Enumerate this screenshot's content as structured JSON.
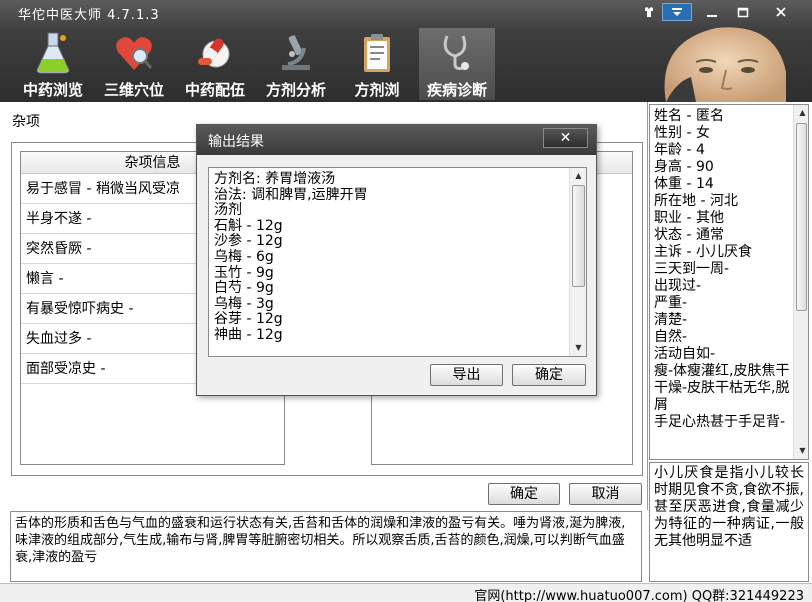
{
  "window": {
    "title": "华佗中医大师 4.7.1.3"
  },
  "toolbar": [
    {
      "label": "中药浏览",
      "icon": "flask-icon"
    },
    {
      "label": "三维穴位",
      "icon": "heart-search-icon"
    },
    {
      "label": "中药配伍",
      "icon": "pills-icon"
    },
    {
      "label": "方剂分析",
      "icon": "microscope-icon"
    },
    {
      "label": "方剂浏",
      "icon": "clipboard-icon"
    },
    {
      "label": "疾病诊断",
      "icon": "stethoscope-icon"
    }
  ],
  "main": {
    "section_title": "杂项",
    "list_header": "杂项信息",
    "items": [
      "易于感冒 - 稍微当风受凉",
      "半身不遂 -",
      "突然昏厥 -",
      "懒言 -",
      "有暴受惊吓病史 -",
      "失血过多 -",
      "面部受凉史 -"
    ],
    "ok_label": "确定",
    "cancel_label": "取消"
  },
  "description": "舌体的形质和舌色与气血的盛衰和运行状态有关,舌苔和舌体的润燥和津液的盈亏有关。唾为肾液,涎为脾液,味津液的组成部分,气生成,输布与肾,脾胃等脏腑密切相关。所以观察舌质,舌苔的颜色,润燥,可以判断气血盛衰,津液的盈亏",
  "patient_info": [
    "姓名 - 匿名",
    "性别 - 女",
    "年龄 - 4",
    "身高 - 90",
    "体重 - 14",
    "所在地 - 河北",
    "职业 - 其他",
    "状态 - 通常",
    "主诉 - 小儿厌食",
    "三天到一周-",
    "出现过-",
    "严重-",
    "清楚-",
    "自然-",
    "活动自如-",
    "瘦-体瘦灌红,皮肤焦干",
    "干燥-皮肤干枯无华,脱屑",
    "手足心热甚于手足背-"
  ],
  "disease_note": "小儿厌食是指小儿较长时期见食不贪,食欲不振,甚至厌恶进食,食量减少为特征的一种病证,一般无其他明显不适",
  "status_bar": "官网(http://www.huatuo007.com) QQ群:321449223",
  "dialog": {
    "title": "输出结果",
    "close_label": "✕",
    "lines": [
      "方剂名: 养胃增液汤",
      "治法: 调和脾胃,运脾开胃",
      "汤剂",
      "石斛 - 12g",
      "沙参 - 12g",
      "乌梅 - 6g",
      "玉竹 - 9g",
      "白芍 - 9g",
      "乌梅 - 3g",
      "谷芽 - 12g",
      "神曲 - 12g"
    ],
    "export_label": "导出",
    "confirm_label": "确定"
  },
  "colors": {
    "titlebar": "#3f3f3f",
    "accent_menu": "#2b6fb3",
    "border": "#8a8a8a"
  }
}
